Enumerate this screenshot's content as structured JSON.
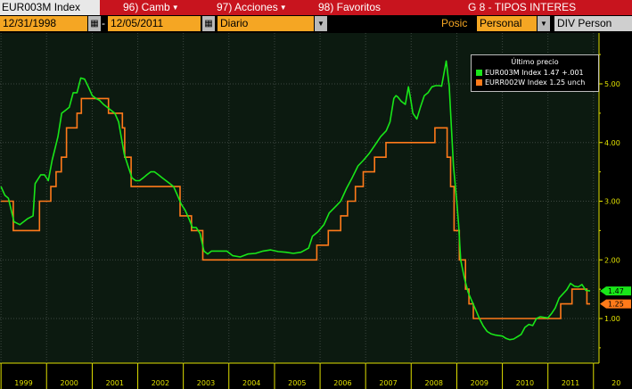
{
  "header": {
    "ticker": "EUR003M Index",
    "menu": [
      {
        "label": "96) Camb"
      },
      {
        "label": "97) Acciones"
      },
      {
        "label": "98) Favoritos"
      }
    ],
    "page_title": "G 8 - TIPOS INTERES"
  },
  "toolbar": {
    "start_date": "12/31/1998",
    "dash": "-",
    "end_date": "12/05/2011",
    "period": "Diario",
    "posic_label": "Posic",
    "posic_value": "Personal",
    "div_value": "DIV Person"
  },
  "colors": {
    "menu_red": "#c8141e",
    "field_orange": "#f5a623",
    "series_green": "#19e619",
    "series_orange": "#ff7a1a",
    "axis_yellow": "#e0e000"
  },
  "chart_data": {
    "type": "line",
    "title": "",
    "xlabel": "",
    "ylabel": "",
    "xlim": [
      "1998-12-31",
      "2011-12-05"
    ],
    "ylim": [
      0,
      5.8
    ],
    "y_ticks": [
      "1.00",
      "2.00",
      "3.00",
      "4.00",
      "5.00"
    ],
    "x_ticks": [
      "1999",
      "2000",
      "2001",
      "2002",
      "2003",
      "2004",
      "2005",
      "2006",
      "2007",
      "2008",
      "2009",
      "2010",
      "2011",
      "20"
    ],
    "grid": true,
    "legend": {
      "placement": "top-right",
      "title": "Último precio",
      "entries": [
        {
          "text": "EUR003M Index  1.47  +.001",
          "color": "#19e619"
        },
        {
          "text": "EURR002W Index 1.25  unch",
          "color": "#ff7a1a"
        }
      ]
    },
    "last_values": [
      {
        "label": "1.47",
        "color": "#19e619",
        "value": 1.47
      },
      {
        "label": "1.25",
        "color": "#ff7a1a",
        "value": 1.25
      }
    ],
    "series": [
      {
        "name": "EUR003M Index",
        "color": "#19e619",
        "points": [
          [
            "1999-01-01",
            3.25
          ],
          [
            "1999-02-01",
            3.1
          ],
          [
            "1999-03-01",
            3.05
          ],
          [
            "1999-04-15",
            2.65
          ],
          [
            "1999-06-01",
            2.6
          ],
          [
            "1999-08-01",
            2.7
          ],
          [
            "1999-09-15",
            2.75
          ],
          [
            "1999-10-01",
            3.3
          ],
          [
            "1999-11-15",
            3.45
          ],
          [
            "1999-12-15",
            3.45
          ],
          [
            "2000-01-15",
            3.35
          ],
          [
            "2000-02-15",
            3.7
          ],
          [
            "2000-03-15",
            3.95
          ],
          [
            "2000-04-01",
            4.1
          ],
          [
            "2000-05-01",
            4.5
          ],
          [
            "2000-06-01",
            4.55
          ],
          [
            "2000-07-01",
            4.6
          ],
          [
            "2000-08-01",
            4.85
          ],
          [
            "2000-09-01",
            4.85
          ],
          [
            "2000-10-01",
            5.1
          ],
          [
            "2000-11-01",
            5.08
          ],
          [
            "2000-12-01",
            4.95
          ],
          [
            "2001-01-01",
            4.8
          ],
          [
            "2001-02-01",
            4.75
          ],
          [
            "2001-03-01",
            4.72
          ],
          [
            "2001-04-01",
            4.65
          ],
          [
            "2001-05-01",
            4.6
          ],
          [
            "2001-06-01",
            4.55
          ],
          [
            "2001-07-01",
            4.5
          ],
          [
            "2001-08-01",
            4.35
          ],
          [
            "2001-09-15",
            3.8
          ],
          [
            "2001-10-15",
            3.6
          ],
          [
            "2001-11-15",
            3.4
          ],
          [
            "2001-12-15",
            3.35
          ],
          [
            "2002-01-15",
            3.35
          ],
          [
            "2002-02-15",
            3.4
          ],
          [
            "2002-03-15",
            3.45
          ],
          [
            "2002-04-15",
            3.5
          ],
          [
            "2002-05-15",
            3.5
          ],
          [
            "2002-06-15",
            3.45
          ],
          [
            "2002-07-15",
            3.4
          ],
          [
            "2002-08-15",
            3.35
          ],
          [
            "2002-09-15",
            3.3
          ],
          [
            "2002-10-15",
            3.25
          ],
          [
            "2002-11-15",
            3.1
          ],
          [
            "2002-12-15",
            2.95
          ],
          [
            "2003-01-15",
            2.85
          ],
          [
            "2003-02-15",
            2.7
          ],
          [
            "2003-03-15",
            2.55
          ],
          [
            "2003-04-15",
            2.55
          ],
          [
            "2003-05-15",
            2.45
          ],
          [
            "2003-06-15",
            2.15
          ],
          [
            "2003-07-15",
            2.1
          ],
          [
            "2003-08-15",
            2.15
          ],
          [
            "2003-09-15",
            2.15
          ],
          [
            "2003-10-15",
            2.15
          ],
          [
            "2003-11-15",
            2.15
          ],
          [
            "2003-12-15",
            2.15
          ],
          [
            "2004-02-01",
            2.07
          ],
          [
            "2004-04-01",
            2.05
          ],
          [
            "2004-06-01",
            2.1
          ],
          [
            "2004-08-01",
            2.11
          ],
          [
            "2004-10-01",
            2.15
          ],
          [
            "2004-12-01",
            2.17
          ],
          [
            "2005-02-01",
            2.14
          ],
          [
            "2005-04-01",
            2.13
          ],
          [
            "2005-06-01",
            2.11
          ],
          [
            "2005-08-01",
            2.13
          ],
          [
            "2005-10-01",
            2.2
          ],
          [
            "2005-11-01",
            2.4
          ],
          [
            "2005-12-15",
            2.48
          ],
          [
            "2006-02-01",
            2.6
          ],
          [
            "2006-03-15",
            2.8
          ],
          [
            "2006-05-01",
            2.9
          ],
          [
            "2006-06-15",
            3.0
          ],
          [
            "2006-08-01",
            3.22
          ],
          [
            "2006-09-15",
            3.4
          ],
          [
            "2006-11-01",
            3.6
          ],
          [
            "2006-12-15",
            3.7
          ],
          [
            "2007-02-01",
            3.82
          ],
          [
            "2007-03-15",
            3.95
          ],
          [
            "2007-05-01",
            4.1
          ],
          [
            "2007-06-15",
            4.2
          ],
          [
            "2007-07-15",
            4.35
          ],
          [
            "2007-08-15",
            4.75
          ],
          [
            "2007-09-01",
            4.8
          ],
          [
            "2007-09-15",
            4.78
          ],
          [
            "2007-10-15",
            4.7
          ],
          [
            "2007-11-15",
            4.65
          ],
          [
            "2007-12-10",
            4.95
          ],
          [
            "2007-12-31",
            4.7
          ],
          [
            "2008-01-15",
            4.5
          ],
          [
            "2008-02-15",
            4.4
          ],
          [
            "2008-03-15",
            4.6
          ],
          [
            "2008-04-15",
            4.8
          ],
          [
            "2008-05-15",
            4.85
          ],
          [
            "2008-06-15",
            4.95
          ],
          [
            "2008-07-15",
            4.97
          ],
          [
            "2008-08-15",
            4.97
          ],
          [
            "2008-09-01",
            4.96
          ],
          [
            "2008-10-08",
            5.39
          ],
          [
            "2008-11-01",
            4.95
          ],
          [
            "2008-11-20",
            4.2
          ],
          [
            "2008-12-05",
            3.6
          ],
          [
            "2008-12-31",
            3.0
          ],
          [
            "2009-01-15",
            2.6
          ],
          [
            "2009-02-01",
            2.0
          ],
          [
            "2009-03-01",
            1.7
          ],
          [
            "2009-04-01",
            1.45
          ],
          [
            "2009-05-01",
            1.3
          ],
          [
            "2009-06-01",
            1.15
          ],
          [
            "2009-07-01",
            1.0
          ],
          [
            "2009-08-01",
            0.87
          ],
          [
            "2009-09-01",
            0.78
          ],
          [
            "2009-10-01",
            0.74
          ],
          [
            "2009-11-01",
            0.72
          ],
          [
            "2009-12-01",
            0.71
          ],
          [
            "2010-01-01",
            0.7
          ],
          [
            "2010-02-01",
            0.66
          ],
          [
            "2010-03-01",
            0.64
          ],
          [
            "2010-04-01",
            0.65
          ],
          [
            "2010-05-01",
            0.69
          ],
          [
            "2010-06-01",
            0.73
          ],
          [
            "2010-07-01",
            0.85
          ],
          [
            "2010-08-01",
            0.9
          ],
          [
            "2010-09-01",
            0.88
          ],
          [
            "2010-10-01",
            1.0
          ],
          [
            "2010-11-01",
            1.03
          ],
          [
            "2010-12-01",
            1.02
          ],
          [
            "2011-01-01",
            1.01
          ],
          [
            "2011-02-01",
            1.09
          ],
          [
            "2011-03-01",
            1.18
          ],
          [
            "2011-04-01",
            1.35
          ],
          [
            "2011-05-01",
            1.42
          ],
          [
            "2011-06-01",
            1.49
          ],
          [
            "2011-07-01",
            1.6
          ],
          [
            "2011-08-01",
            1.55
          ],
          [
            "2011-09-01",
            1.54
          ],
          [
            "2011-10-01",
            1.58
          ],
          [
            "2011-11-01",
            1.48
          ],
          [
            "2011-12-05",
            1.47
          ]
        ]
      },
      {
        "name": "EURR002W Index",
        "color": "#ff7a1a",
        "steps": [
          [
            "1999-01-01",
            3.0
          ],
          [
            "1999-04-09",
            2.5
          ],
          [
            "1999-11-05",
            3.0
          ],
          [
            "2000-02-04",
            3.25
          ],
          [
            "2000-03-17",
            3.5
          ],
          [
            "2000-04-28",
            3.75
          ],
          [
            "2000-06-09",
            4.25
          ],
          [
            "2000-06-28",
            4.25
          ],
          [
            "2000-09-01",
            4.5
          ],
          [
            "2000-10-06",
            4.75
          ],
          [
            "2001-05-11",
            4.5
          ],
          [
            "2001-08-31",
            4.25
          ],
          [
            "2001-09-18",
            3.75
          ],
          [
            "2001-11-09",
            3.25
          ],
          [
            "2002-12-06",
            2.75
          ],
          [
            "2003-03-07",
            2.5
          ],
          [
            "2003-06-06",
            2.0
          ],
          [
            "2005-12-06",
            2.25
          ],
          [
            "2006-03-08",
            2.5
          ],
          [
            "2006-06-15",
            2.75
          ],
          [
            "2006-08-09",
            3.0
          ],
          [
            "2006-10-11",
            3.25
          ],
          [
            "2006-12-13",
            3.5
          ],
          [
            "2007-03-14",
            3.75
          ],
          [
            "2007-06-13",
            4.0
          ],
          [
            "2008-07-09",
            4.25
          ],
          [
            "2008-10-15",
            3.75
          ],
          [
            "2008-11-12",
            3.25
          ],
          [
            "2008-12-10",
            2.5
          ],
          [
            "2009-01-21",
            2.0
          ],
          [
            "2009-03-11",
            1.5
          ],
          [
            "2009-04-08",
            1.25
          ],
          [
            "2009-05-13",
            1.0
          ],
          [
            "2011-04-13",
            1.25
          ],
          [
            "2011-07-13",
            1.5
          ],
          [
            "2011-11-09",
            1.25
          ],
          [
            "2011-12-05",
            1.25
          ]
        ]
      }
    ]
  }
}
